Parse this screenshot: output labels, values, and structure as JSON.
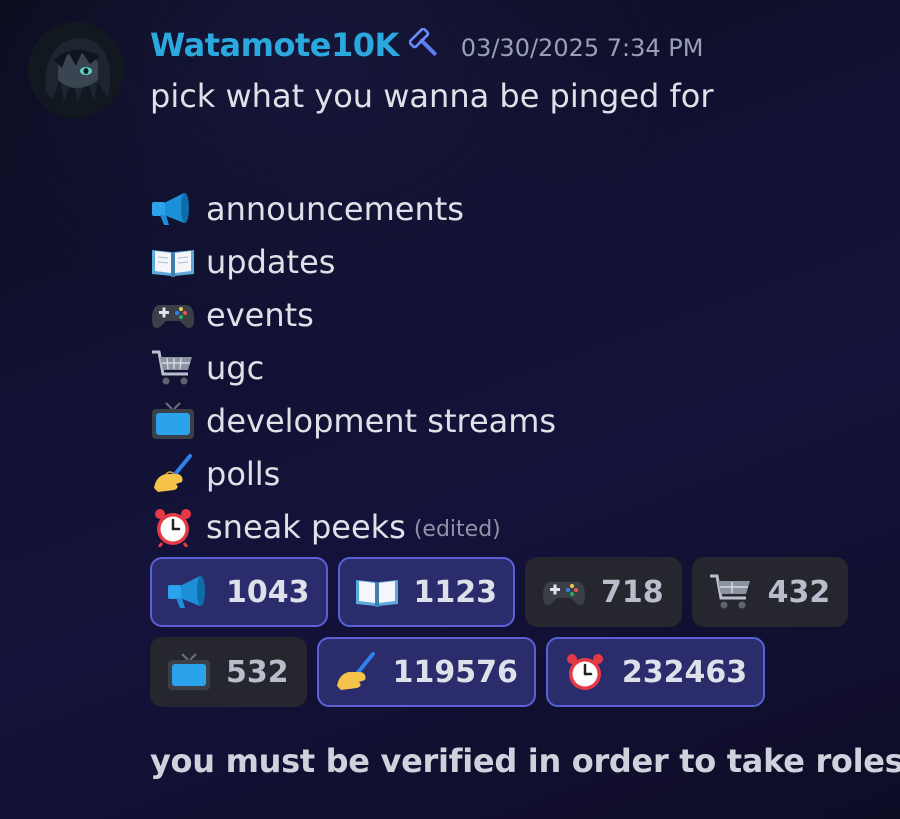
{
  "message": {
    "author": "Watamote10K",
    "timestamp": "03/30/2025 7:34 PM",
    "intro": "pick what you wanna be pinged for",
    "roles": [
      {
        "emoji": "megaphone-icon",
        "label": "announcements"
      },
      {
        "emoji": "open-book-icon",
        "label": "updates"
      },
      {
        "emoji": "game-controller-icon",
        "label": "events"
      },
      {
        "emoji": "shopping-cart-icon",
        "label": "ugc"
      },
      {
        "emoji": "television-icon",
        "label": "development streams"
      },
      {
        "emoji": "writing-hand-icon",
        "label": "polls"
      },
      {
        "emoji": "alarm-clock-icon",
        "label": "sneak peeks"
      }
    ],
    "edited_label": "(edited)",
    "footer": "you must be verified in order to take roles"
  },
  "reactions": [
    {
      "emoji": "megaphone-icon",
      "count": "1043",
      "active": true
    },
    {
      "emoji": "open-book-icon",
      "count": "1123",
      "active": true
    },
    {
      "emoji": "game-controller-icon",
      "count": "718",
      "active": false
    },
    {
      "emoji": "shopping-cart-icon",
      "count": "432",
      "active": false
    },
    {
      "emoji": "television-icon",
      "count": "532",
      "active": false
    },
    {
      "emoji": "writing-hand-icon",
      "count": "119576",
      "active": true
    },
    {
      "emoji": "alarm-clock-icon",
      "count": "232463",
      "active": true
    }
  ],
  "colors": {
    "username": "#2ba8de",
    "active_reaction_bg": "#2a2c6b",
    "active_reaction_border": "#5a61d6",
    "inactive_reaction_bg": "#26262e"
  }
}
